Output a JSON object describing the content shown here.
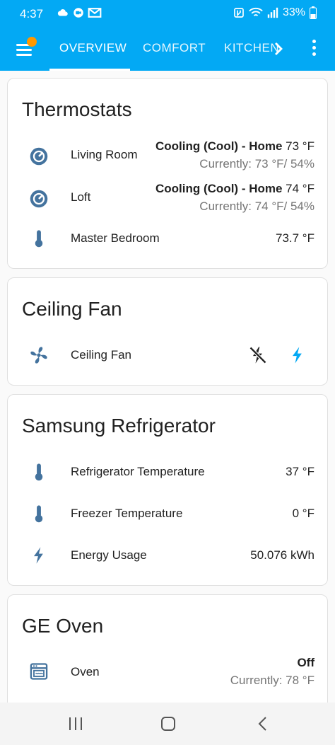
{
  "status_bar": {
    "time": "4:37",
    "battery": "33%",
    "icons": [
      "cloud-icon",
      "video-call-icon",
      "mail-icon",
      "nfc-icon",
      "wifi-icon",
      "signal-icon",
      "battery-icon"
    ]
  },
  "app_bar": {
    "tabs": [
      {
        "label": "OVERVIEW",
        "active": true
      },
      {
        "label": "COMFORT",
        "active": false
      },
      {
        "label": "KITCHEN",
        "active": false
      }
    ],
    "accent": "#03a9f4",
    "badge_color": "#ff9800"
  },
  "cards": {
    "thermostats": {
      "title": "Thermostats",
      "rows": [
        {
          "name": "Living Room",
          "mode": "Cooling (Cool) - Home",
          "target": "73 °F",
          "current": "Currently: 73 °F/ 54%",
          "icon": "thermostat-icon"
        },
        {
          "name": "Loft",
          "mode": "Cooling (Cool) - Home",
          "target": "74 °F",
          "current": "Currently: 74 °F/ 54%",
          "icon": "thermostat-icon"
        },
        {
          "name": "Master Bedroom",
          "value": "73.7 °F",
          "icon": "thermometer-icon"
        }
      ]
    },
    "ceiling_fan": {
      "title": "Ceiling Fan",
      "rows": [
        {
          "name": "Ceiling Fan",
          "icon": "fan-icon"
        }
      ]
    },
    "refrigerator": {
      "title": "Samsung Refrigerator",
      "rows": [
        {
          "name": "Refrigerator Temperature",
          "value": "37 °F",
          "icon": "thermometer-icon"
        },
        {
          "name": "Freezer Temperature",
          "value": "0 °F",
          "icon": "thermometer-icon"
        },
        {
          "name": "Energy Usage",
          "value": "50.076 kWh",
          "icon": "lightning-icon"
        }
      ]
    },
    "oven": {
      "title": "GE Oven",
      "rows": [
        {
          "name": "Oven",
          "state": "Off",
          "current": "Currently: 78 °F",
          "icon": "oven-icon"
        }
      ]
    }
  },
  "colors": {
    "icon": "#44739e",
    "active_toggle": "#03a9f4",
    "text_muted": "#757575"
  }
}
